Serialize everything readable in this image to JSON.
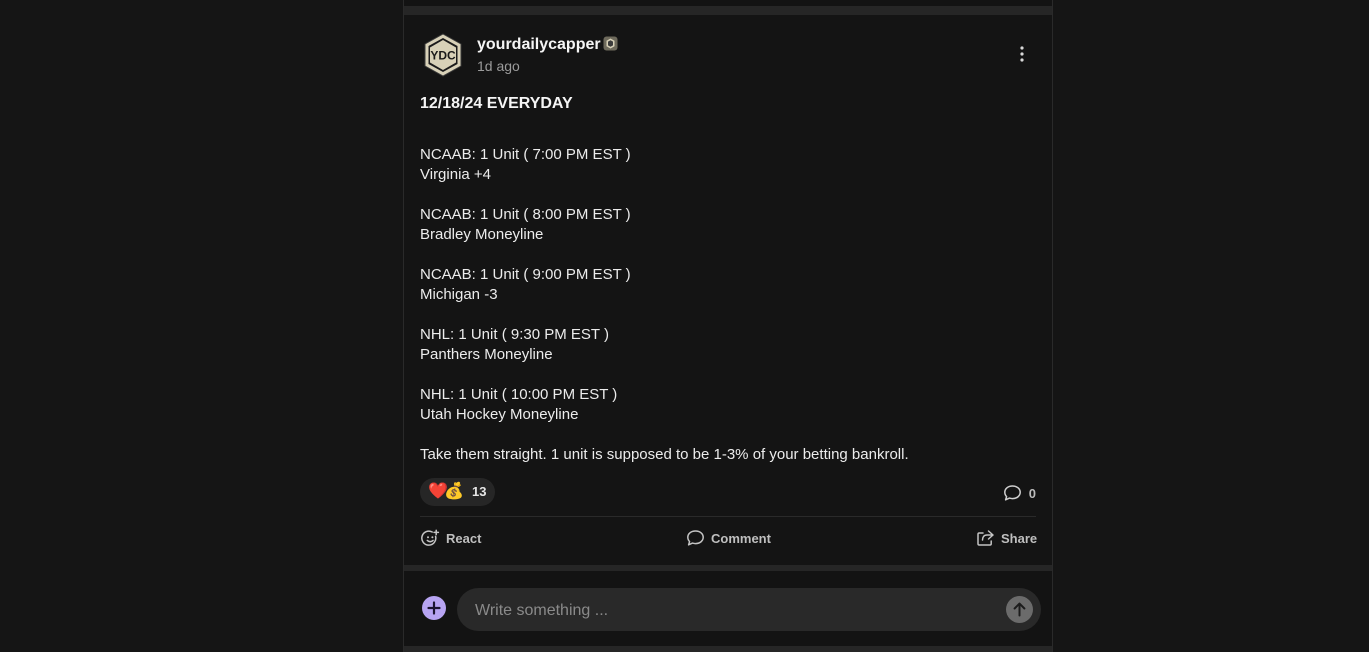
{
  "post": {
    "author": {
      "name": "yourdailycapper",
      "avatar_text": "YDC",
      "badge_icon": "verified-badge-icon"
    },
    "timestamp": "1d ago",
    "title": "12/18/24 EVERYDAY",
    "picks": [
      {
        "header": "NCAAB: 1 Unit ( 7:00 PM EST )",
        "selection": "Virginia +4"
      },
      {
        "header": "NCAAB: 1 Unit ( 8:00 PM EST )",
        "selection": "Bradley Moneyline"
      },
      {
        "header": "NCAAB: 1 Unit ( 9:00 PM EST )",
        "selection": "Michigan -3"
      },
      {
        "header": "NHL: 1 Unit ( 9:30 PM EST )",
        "selection": "Panthers Moneyline"
      },
      {
        "header": "NHL: 1 Unit ( 10:00 PM EST )",
        "selection": "Utah Hockey Moneyline"
      }
    ],
    "note": "Take them straight. 1 unit is supposed to be 1-3% of your betting bankroll.",
    "reactions": {
      "emojis": [
        "❤️",
        "💰"
      ],
      "count": "13"
    },
    "comments_count": "0",
    "actions": {
      "react_label": "React",
      "comment_label": "Comment",
      "share_label": "Share"
    }
  },
  "composer": {
    "placeholder": "Write something ...",
    "add_icon": "plus-icon",
    "send_icon": "arrow-up-icon"
  },
  "colors": {
    "page_background": "#151515",
    "card_background": "#141414",
    "accent_add_button": "#b7a4f2",
    "input_background": "#292929",
    "send_button": "#6b6b6b"
  }
}
